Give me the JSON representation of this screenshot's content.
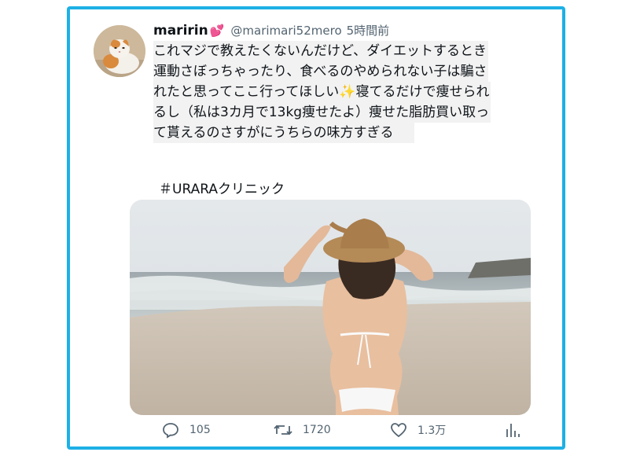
{
  "tweet": {
    "display_name": "maririn",
    "name_emoji": "💕",
    "handle": "@marimari52mero",
    "time": "5時間前",
    "body_lines": [
      "これマジで教えたくないんだけど、ダイエットするとき",
      "運動さぼっちゃったり、食べるのやめられない子は騙さ",
      "れたと思ってここ行ってほしい✨寝てるだけで痩せられ",
      "るし（私は3カ月で13kg痩せたよ）痩せた脂肪買い取っ",
      "て貰えるのさすがにうちらの味方すぎる"
    ],
    "hashtag": "＃URARAクリニック",
    "stats": {
      "replies": "105",
      "retweets": "1720",
      "likes": "1.3万"
    }
  },
  "icons": {
    "reply": "reply-icon",
    "retweet": "retweet-icon",
    "like": "heart-icon",
    "views": "analytics-icon"
  },
  "colors": {
    "card_border": "#1db0e5",
    "secondary_text": "#536471"
  }
}
